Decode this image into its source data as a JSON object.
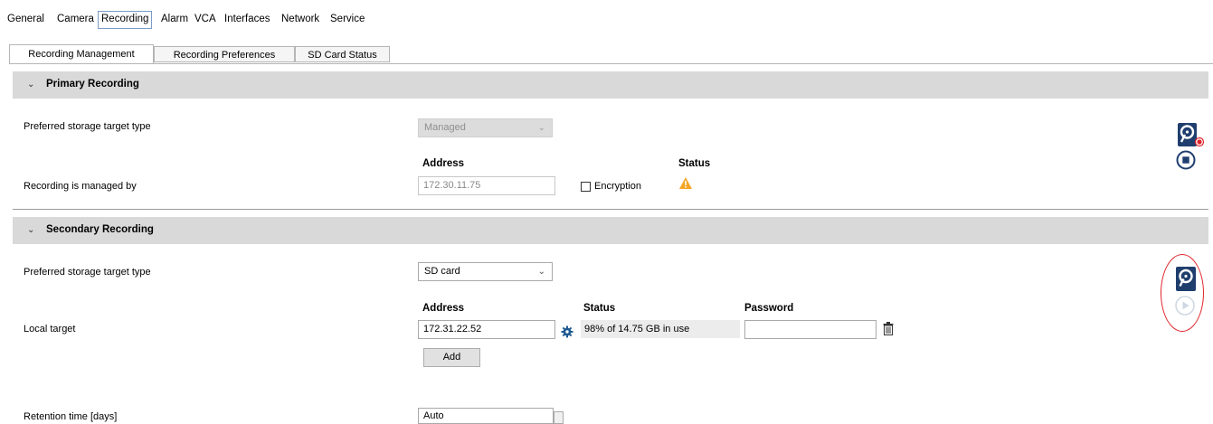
{
  "menu": [
    "General",
    "Camera",
    "Recording",
    "Alarm",
    "VCA",
    "Interfaces",
    "Network",
    "Service"
  ],
  "active_menu": "Recording",
  "tabs": [
    "Recording Management",
    "Recording Preferences",
    "SD Card Status"
  ],
  "primary": {
    "title": "Primary Recording",
    "storage_label": "Preferred storage target type",
    "storage_value": "Managed",
    "address_header": "Address",
    "status_header": "Status",
    "managed_label": "Recording is managed by",
    "address_value": "172.30.11.75",
    "encryption_label": "Encryption"
  },
  "secondary": {
    "title": "Secondary Recording",
    "storage_label": "Preferred storage target type",
    "storage_value": "SD card",
    "address_header": "Address",
    "status_header": "Status",
    "password_header": "Password",
    "local_target_label": "Local target",
    "address_value": "172.31.22.52",
    "status_value": "98% of 14.75 GB in use",
    "password_value": "",
    "add_label": "Add",
    "retention_label": "Retention time [days]",
    "retention_value": "Auto"
  },
  "colors": {
    "accent_blue": "#1f3e6e",
    "warning": "#f5a623",
    "highlight_ring": "#e0242b",
    "section_bg": "#d9d9d9"
  },
  "icons": [
    "hard-drive-icon",
    "record-indicator-icon",
    "stop-icon",
    "warning-icon",
    "gear-icon",
    "trash-icon",
    "play-icon",
    "chevron-down-icon"
  ]
}
